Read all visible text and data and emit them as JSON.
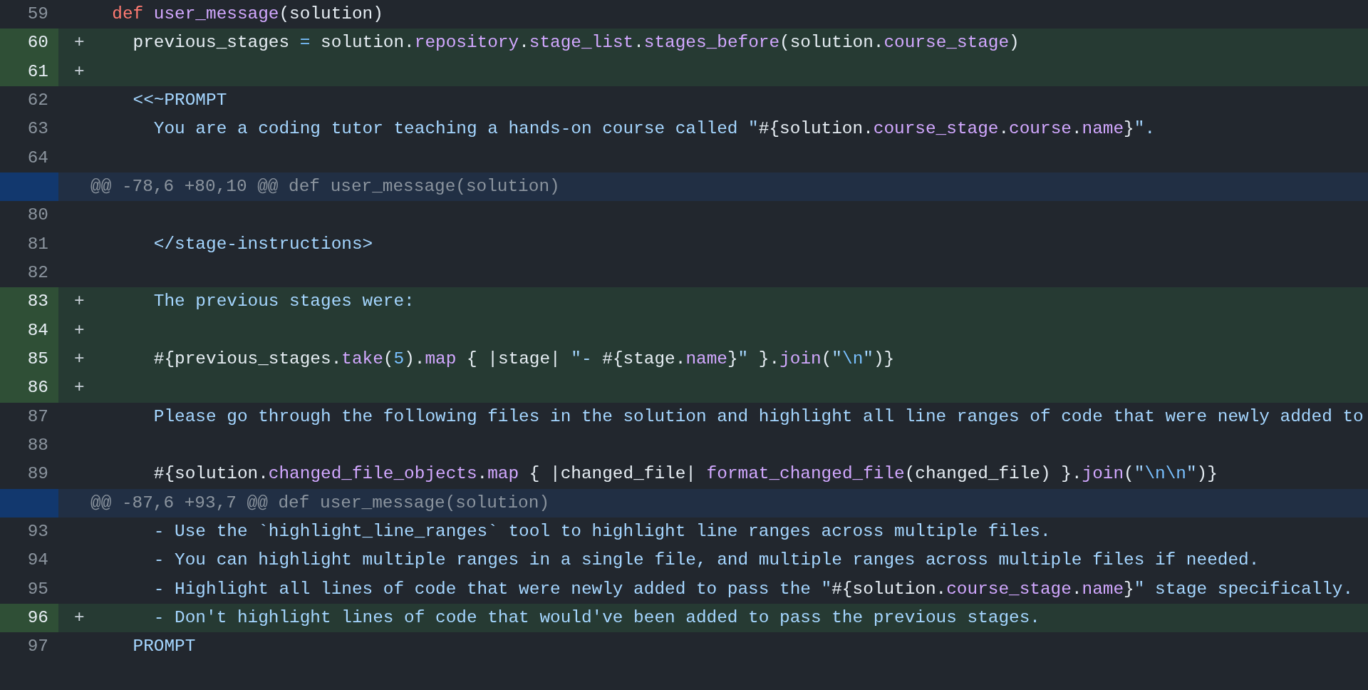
{
  "rows": [
    {
      "kind": "line",
      "number": "59",
      "added": false,
      "tokens": [
        {
          "kind": "keyword",
          "text": "  def"
        },
        {
          "kind": "name",
          "text": " user_message"
        },
        {
          "kind": "plain",
          "text": "(solution)"
        }
      ]
    },
    {
      "kind": "line",
      "number": "60",
      "added": true,
      "marker": "+",
      "tokens": [
        {
          "kind": "plain",
          "text": "    previous_stages "
        },
        {
          "kind": "constant",
          "text": "="
        },
        {
          "kind": "plain",
          "text": " solution."
        },
        {
          "kind": "name",
          "text": "repository"
        },
        {
          "kind": "plain",
          "text": "."
        },
        {
          "kind": "name",
          "text": "stage_list"
        },
        {
          "kind": "plain",
          "text": "."
        },
        {
          "kind": "name",
          "text": "stages_before"
        },
        {
          "kind": "plain",
          "text": "(solution."
        },
        {
          "kind": "name",
          "text": "course_stage"
        },
        {
          "kind": "plain",
          "text": ")"
        }
      ]
    },
    {
      "kind": "line",
      "number": "61",
      "added": true,
      "marker": "+"
    },
    {
      "kind": "line",
      "number": "62",
      "added": false,
      "tokens": [
        {
          "kind": "string",
          "text": "    <<~PROMPT"
        }
      ]
    },
    {
      "kind": "line",
      "number": "63",
      "added": false,
      "tokens": [
        {
          "kind": "string",
          "text": "      You are a coding tutor teaching a hands-on course called \""
        },
        {
          "kind": "plain",
          "text": "#{solution."
        },
        {
          "kind": "name",
          "text": "course_stage"
        },
        {
          "kind": "plain",
          "text": "."
        },
        {
          "kind": "name",
          "text": "course"
        },
        {
          "kind": "plain",
          "text": "."
        },
        {
          "kind": "name",
          "text": "name"
        },
        {
          "kind": "plain",
          "text": "}"
        },
        {
          "kind": "string",
          "text": "\"."
        }
      ]
    },
    {
      "kind": "line",
      "number": "64",
      "added": false
    },
    {
      "kind": "hunk",
      "text": "@@ -78,6 +80,10 @@ def user_message(solution)"
    },
    {
      "kind": "line",
      "number": "80",
      "added": false
    },
    {
      "kind": "line",
      "number": "81",
      "added": false,
      "tokens": [
        {
          "kind": "string",
          "text": "      </stage-instructions>"
        }
      ]
    },
    {
      "kind": "line",
      "number": "82",
      "added": false
    },
    {
      "kind": "line",
      "number": "83",
      "added": true,
      "marker": "+",
      "tokens": [
        {
          "kind": "string",
          "text": "      The previous stages were:"
        }
      ]
    },
    {
      "kind": "line",
      "number": "84",
      "added": true,
      "marker": "+"
    },
    {
      "kind": "line",
      "number": "85",
      "added": true,
      "marker": "+",
      "tokens": [
        {
          "kind": "plain",
          "text": "      #{previous_stages."
        },
        {
          "kind": "name",
          "text": "take"
        },
        {
          "kind": "plain",
          "text": "("
        },
        {
          "kind": "constant",
          "text": "5"
        },
        {
          "kind": "plain",
          "text": ")."
        },
        {
          "kind": "name",
          "text": "map"
        },
        {
          "kind": "plain",
          "text": " { |stage| "
        },
        {
          "kind": "string",
          "text": "\"- "
        },
        {
          "kind": "plain",
          "text": "#{stage."
        },
        {
          "kind": "name",
          "text": "name"
        },
        {
          "kind": "plain",
          "text": "}"
        },
        {
          "kind": "string",
          "text": "\""
        },
        {
          "kind": "plain",
          "text": " }."
        },
        {
          "kind": "name",
          "text": "join"
        },
        {
          "kind": "plain",
          "text": "("
        },
        {
          "kind": "string",
          "text": "\""
        },
        {
          "kind": "constant",
          "text": "\\n"
        },
        {
          "kind": "string",
          "text": "\""
        },
        {
          "kind": "plain",
          "text": ")}"
        }
      ]
    },
    {
      "kind": "line",
      "number": "86",
      "added": true,
      "marker": "+"
    },
    {
      "kind": "line",
      "number": "87",
      "added": false,
      "tokens": [
        {
          "kind": "string",
          "text": "      Please go through the following files in the solution and highlight all line ranges of code that were newly added to"
        }
      ]
    },
    {
      "kind": "line",
      "number": "88",
      "added": false
    },
    {
      "kind": "line",
      "number": "89",
      "added": false,
      "tokens": [
        {
          "kind": "plain",
          "text": "      #{solution."
        },
        {
          "kind": "name",
          "text": "changed_file_objects"
        },
        {
          "kind": "plain",
          "text": "."
        },
        {
          "kind": "name",
          "text": "map"
        },
        {
          "kind": "plain",
          "text": " { |changed_file| "
        },
        {
          "kind": "name",
          "text": "format_changed_file"
        },
        {
          "kind": "plain",
          "text": "(changed_file) }."
        },
        {
          "kind": "name",
          "text": "join"
        },
        {
          "kind": "plain",
          "text": "("
        },
        {
          "kind": "string",
          "text": "\""
        },
        {
          "kind": "constant",
          "text": "\\n\\n"
        },
        {
          "kind": "string",
          "text": "\""
        },
        {
          "kind": "plain",
          "text": ")}"
        }
      ]
    },
    {
      "kind": "hunk",
      "text": "@@ -87,6 +93,7 @@ def user_message(solution)"
    },
    {
      "kind": "line",
      "number": "93",
      "added": false,
      "tokens": [
        {
          "kind": "string",
          "text": "      - Use the `highlight_line_ranges` tool to highlight line ranges across multiple files."
        }
      ]
    },
    {
      "kind": "line",
      "number": "94",
      "added": false,
      "tokens": [
        {
          "kind": "string",
          "text": "      - You can highlight multiple ranges in a single file, and multiple ranges across multiple files if needed."
        }
      ]
    },
    {
      "kind": "line",
      "number": "95",
      "added": false,
      "tokens": [
        {
          "kind": "string",
          "text": "      - Highlight all lines of code that were newly added to pass the \""
        },
        {
          "kind": "plain",
          "text": "#{solution."
        },
        {
          "kind": "name",
          "text": "course_stage"
        },
        {
          "kind": "plain",
          "text": "."
        },
        {
          "kind": "name",
          "text": "name"
        },
        {
          "kind": "plain",
          "text": "}"
        },
        {
          "kind": "string",
          "text": "\" stage specifically."
        }
      ]
    },
    {
      "kind": "line",
      "number": "96",
      "added": true,
      "marker": "+",
      "tokens": [
        {
          "kind": "string",
          "text": "      - Don't highlight lines of code that would've been added to pass the previous stages."
        }
      ]
    },
    {
      "kind": "line",
      "number": "97",
      "added": false,
      "tokens": [
        {
          "kind": "string",
          "text": "    PROMPT"
        }
      ]
    }
  ]
}
